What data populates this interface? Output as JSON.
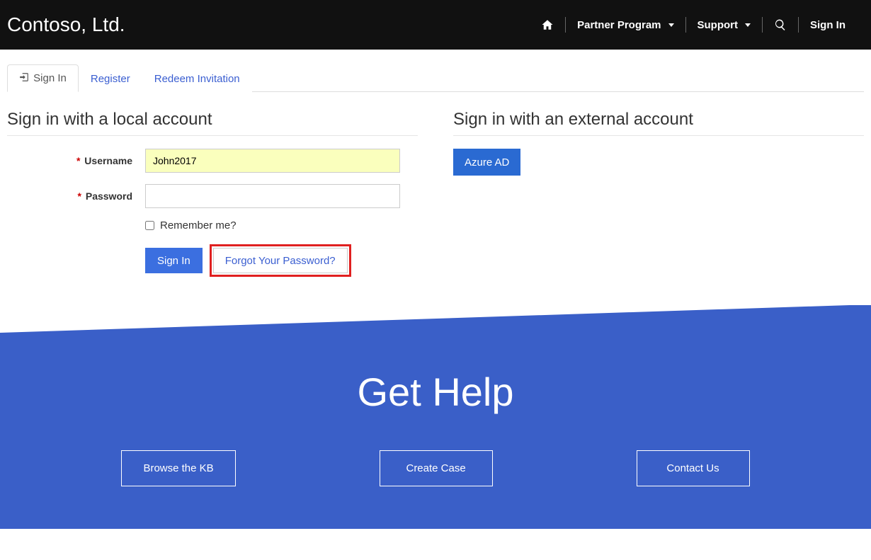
{
  "header": {
    "brand": "Contoso, Ltd.",
    "nav": {
      "partner_program": "Partner Program",
      "support": "Support",
      "sign_in": "Sign In"
    }
  },
  "tabs": {
    "sign_in": "Sign In",
    "register": "Register",
    "redeem": "Redeem Invitation"
  },
  "local": {
    "title": "Sign in with a local account",
    "username_label": "Username",
    "username_value": "John2017",
    "password_label": "Password",
    "password_value": "",
    "remember_label": "Remember me?",
    "sign_in_button": "Sign In",
    "forgot_button": "Forgot Your Password?"
  },
  "external": {
    "title": "Sign in with an external account",
    "azure_button": "Azure AD"
  },
  "help": {
    "title": "Get Help",
    "browse": "Browse the KB",
    "create": "Create Case",
    "contact": "Contact Us"
  }
}
